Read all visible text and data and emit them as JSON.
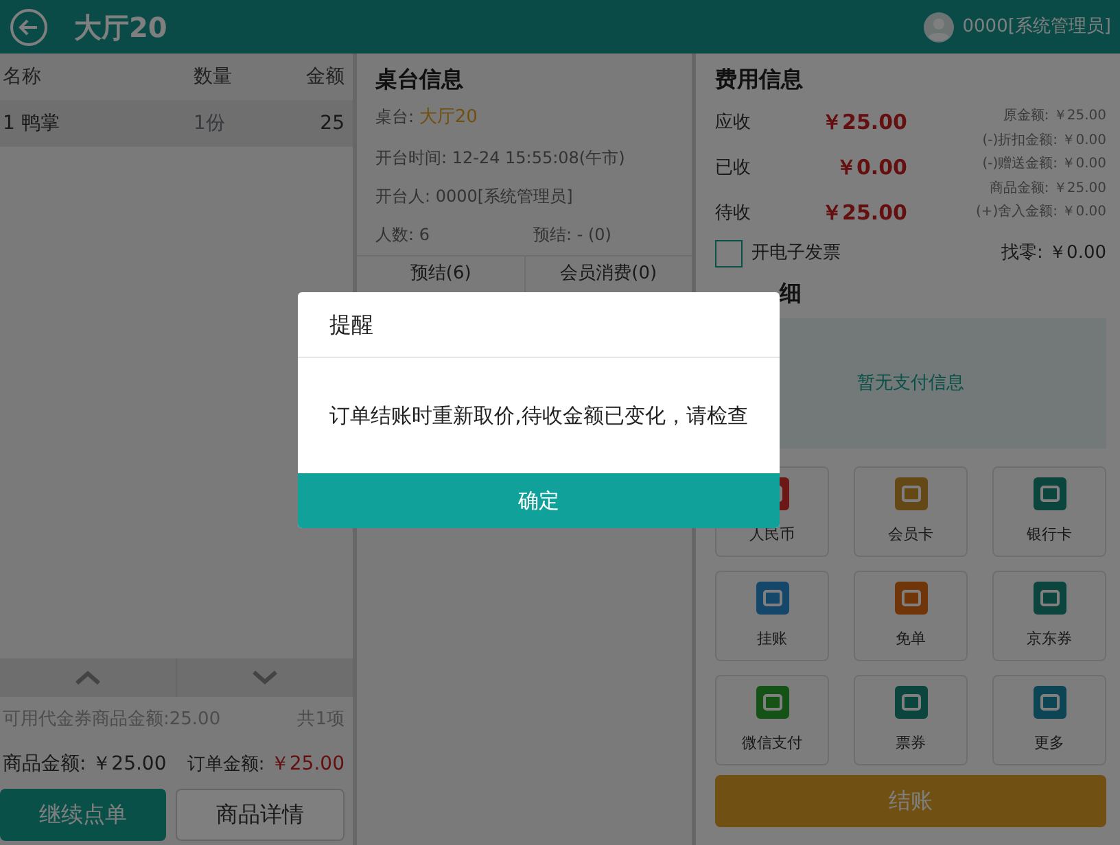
{
  "header": {
    "title": "大厅20",
    "user": "0000[系统管理员]"
  },
  "order": {
    "columns": [
      "名称",
      "数量",
      "金额"
    ],
    "rows": [
      {
        "name": "1 鸭掌",
        "qty": "1份",
        "amount": "25"
      }
    ],
    "voucher_note": "可用代金券商品金额:25.00",
    "count": "共1项",
    "goods_total_label": "商品金额:",
    "goods_total": "￥25.00",
    "order_total_label": "订单金额:",
    "order_total": "￥25.00",
    "buttons": [
      "继续点单",
      "商品详情"
    ]
  },
  "table_info": {
    "title": "桌台信息",
    "table_label": "桌台:",
    "table_value": "大厅20",
    "open_time": "开台时间: 12-24 15:55:08(午市)",
    "opener": "开台人: 0000[系统管理员]",
    "guests": "人数: 6",
    "presettle": "预结: - (0)",
    "tabs": [
      {
        "label": "预结(6)",
        "selected": false
      },
      {
        "label": "会员消费(0)",
        "selected": false
      }
    ]
  },
  "fees": {
    "title": "费用信息",
    "lines": [
      {
        "label": "应收",
        "value": "￥25.00"
      },
      {
        "label": "已收",
        "value": "￥0.00"
      },
      {
        "label": "待收",
        "value": "￥25.00"
      }
    ],
    "breakdown": [
      "原金额: ￥25.00",
      "(-)折扣金额: ￥0.00",
      "(-)赠送金额: ￥0.00",
      "商品金额: ￥25.00",
      "(+)舍入金额: ￥0.00"
    ],
    "e_invoice": {
      "label": "开电子发票",
      "checked": false
    },
    "change": "找零: ￥0.00"
  },
  "payment": {
    "title": "细",
    "empty": "暂无支付信息",
    "methods": [
      {
        "label": "人民币",
        "kind": "cash"
      },
      {
        "label": "会员卡",
        "kind": "member"
      },
      {
        "label": "银行卡",
        "kind": "bank"
      },
      {
        "label": "挂账",
        "kind": "credit"
      },
      {
        "label": "免单",
        "kind": "free"
      },
      {
        "label": "京东券",
        "kind": "coupon"
      },
      {
        "label": "微信支付",
        "kind": "wechat"
      },
      {
        "label": "票券",
        "kind": "ticket"
      },
      {
        "label": "更多",
        "kind": "more"
      }
    ],
    "checkout": "结账"
  },
  "dialog": {
    "title": "提醒",
    "message": "订单结账时重新取价,待收金额已变化，请检查",
    "confirm": "确定"
  }
}
